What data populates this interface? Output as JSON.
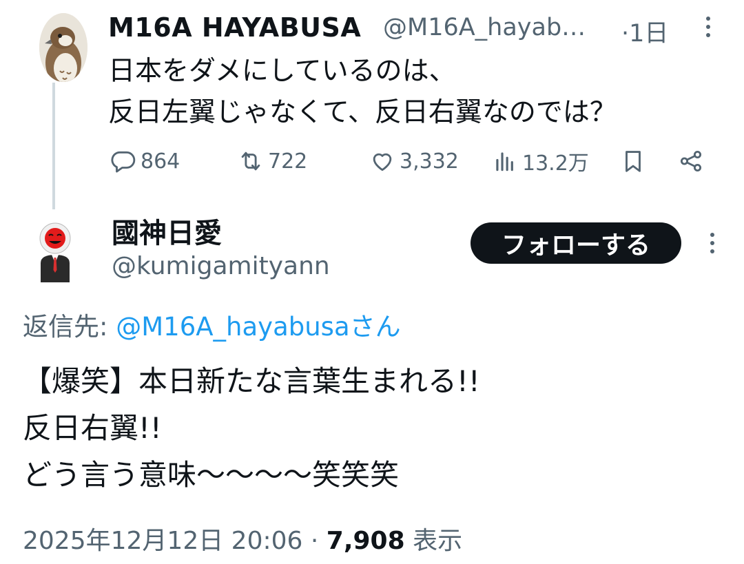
{
  "parent_tweet": {
    "display_name": "M16A  HAYABUSA",
    "handle": "@M16A_hayab…",
    "time": "·1日",
    "text": "日本をダメにしているのは、\n反日左翼じゃなくて、反日右翼なのでは？",
    "actions": {
      "replies": "864",
      "retweets": "722",
      "likes": "3,332",
      "views": "13.2万"
    }
  },
  "reply_tweet": {
    "display_name": "國神日愛",
    "handle": "@kumigamityann",
    "follow_label": "フォローする",
    "reply_to_prefix": "返信先: ",
    "reply_to_mention": "@M16A_hayabusaさん",
    "text": "【爆笑】本日新たな言葉生まれる!!\n反日右翼!!\nどう言う意味〜〜〜〜笑笑笑",
    "timestamp": "2025年12月12日 20:06 · ",
    "views_count": "7,908",
    "views_label": " 表示"
  },
  "colors": {
    "text_primary": "#0f1419",
    "text_secondary": "#536471",
    "link": "#1d9bf0",
    "thread_line": "#cfd9de",
    "follow_button_bg": "#0f1419"
  },
  "icons": [
    "reply-icon",
    "retweet-icon",
    "like-icon",
    "views-icon",
    "bookmark-icon",
    "share-icon",
    "more-icon"
  ]
}
